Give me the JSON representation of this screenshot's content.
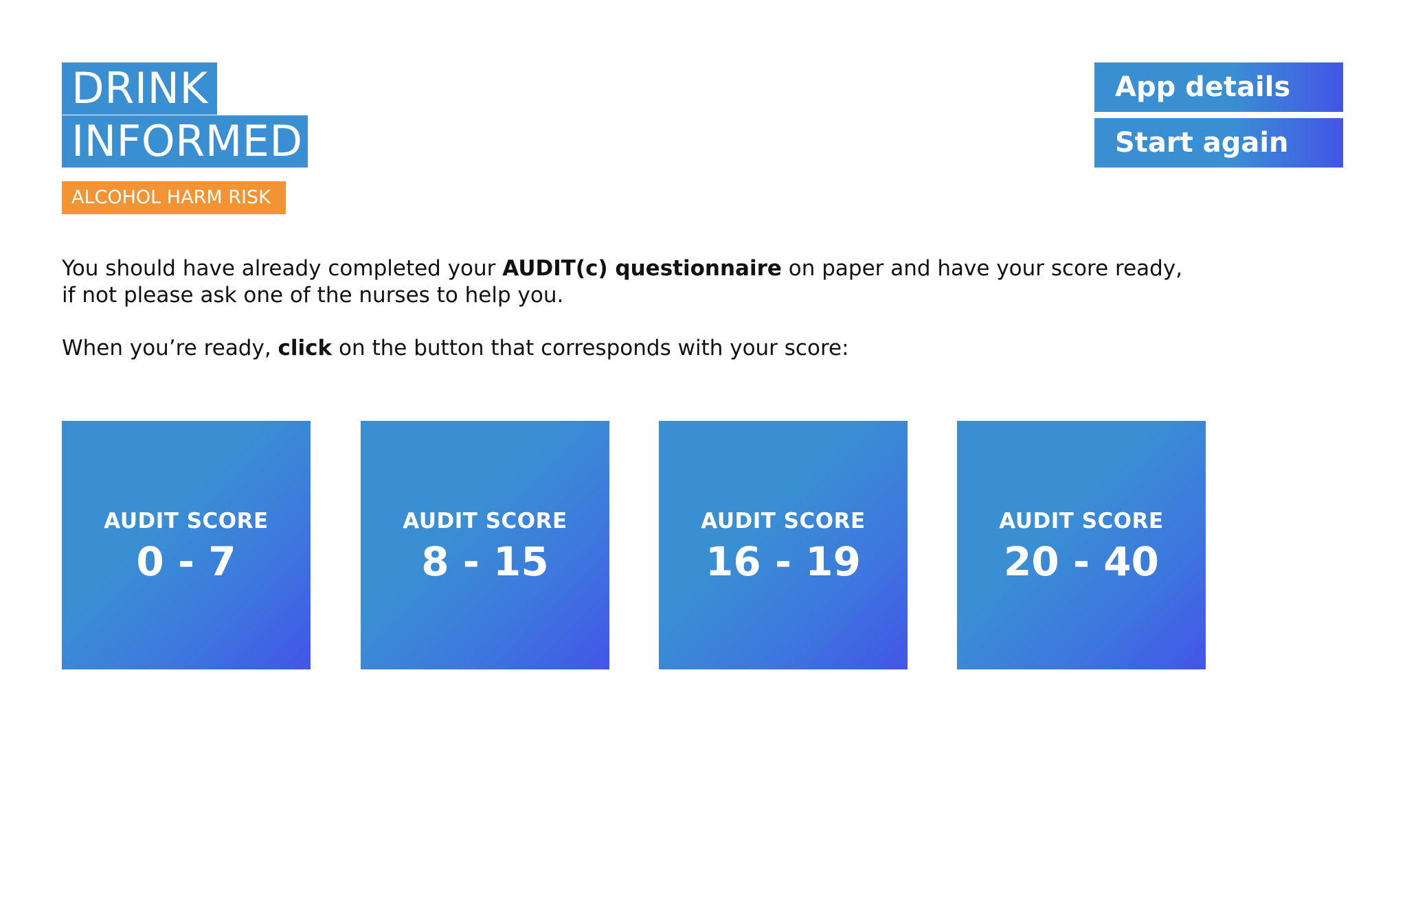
{
  "logo": {
    "line1": "DRINK",
    "line2": "INFORMED",
    "tagline": "ALCOHOL HARM RISK"
  },
  "header": {
    "app_details_label": "App details",
    "start_again_label": "Start again"
  },
  "intro": {
    "p1_before": "You should have already completed your ",
    "p1_bold": "AUDIT(c) questionnaire",
    "p1_after": " on paper and have your score ready,",
    "p1_line2": "if not please ask one of the nurses to help you.",
    "p2_before": "When you’re ready, ",
    "p2_bold": "click",
    "p2_after": " on the button that corresponds with your score:"
  },
  "scores": [
    {
      "label": "AUDIT SCORE",
      "range": "0 - 7"
    },
    {
      "label": "AUDIT SCORE",
      "range": "8 - 15"
    },
    {
      "label": "AUDIT SCORE",
      "range": "16 - 19"
    },
    {
      "label": "AUDIT SCORE",
      "range": "20 - 40"
    }
  ],
  "colors": {
    "brand_blue": "#3a8fd3",
    "gradient_end": "#4355e8",
    "accent_orange": "#f29433"
  }
}
